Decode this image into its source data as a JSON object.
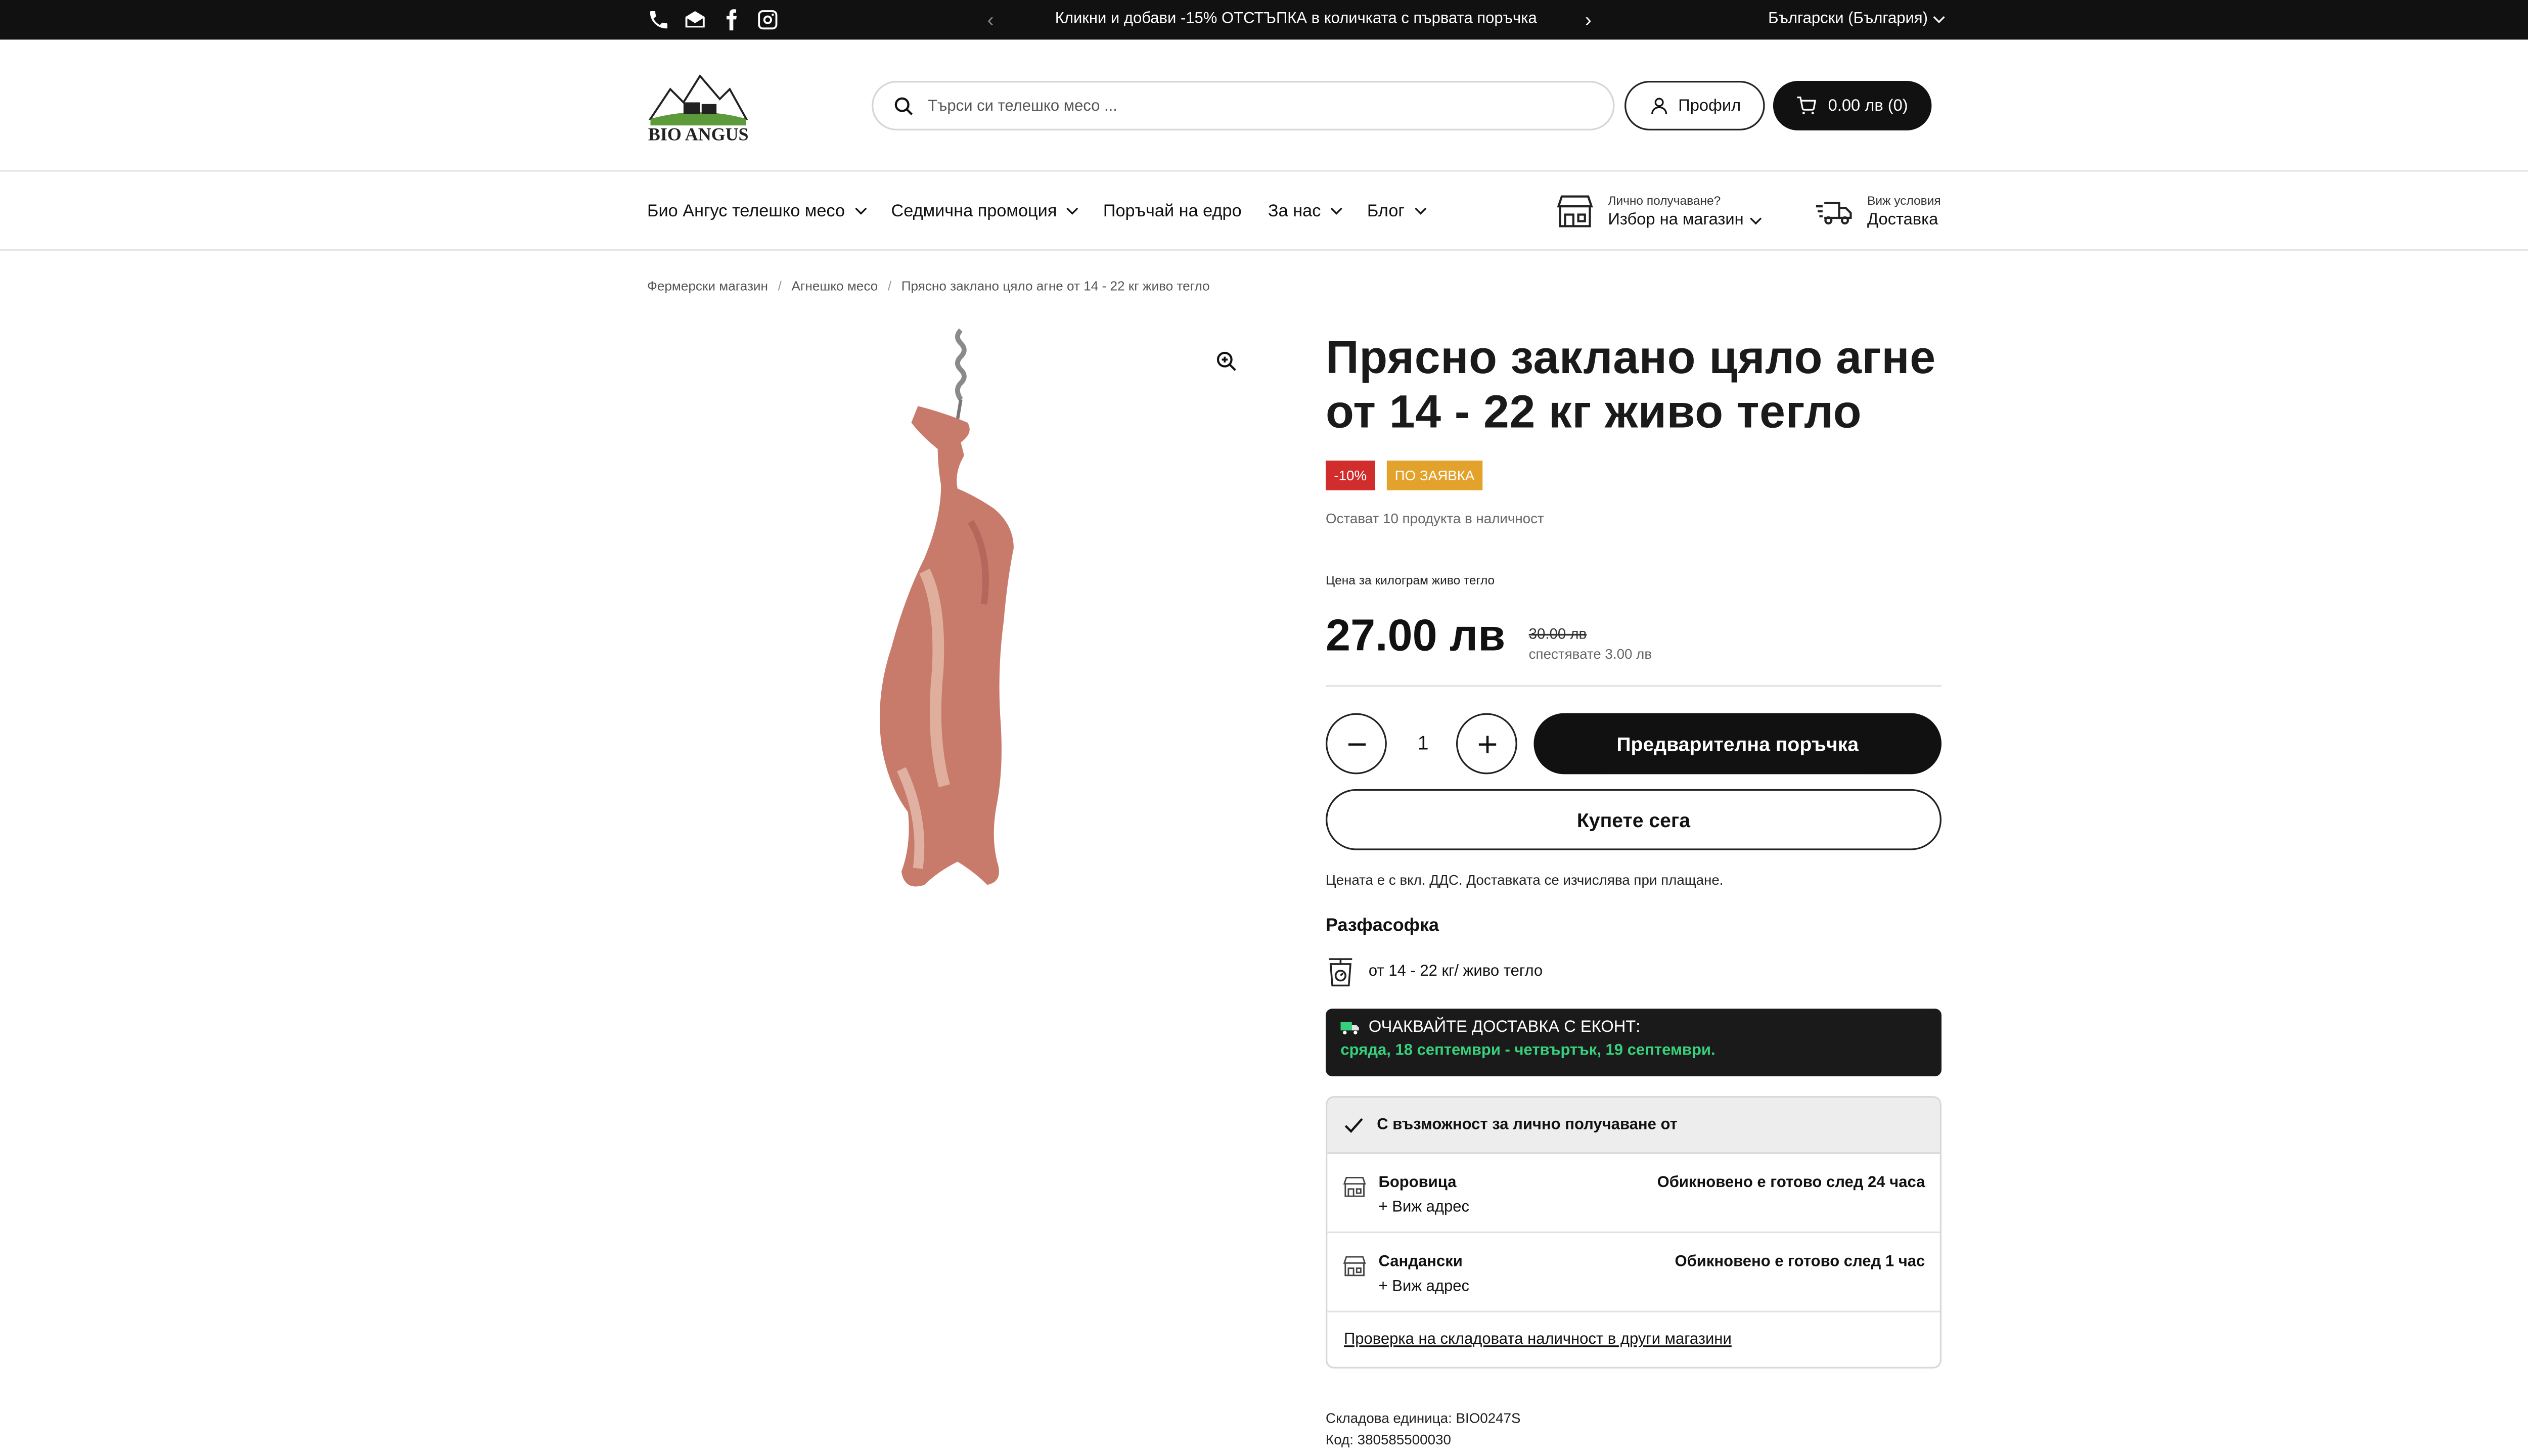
{
  "announcement": {
    "text": "Кликни и добави -15% ОТСТЪПКА в количката с първата поръчка",
    "prev_icon": "chevron-left-icon",
    "next_icon": "chevron-right-icon",
    "language": "Български (България)",
    "socials": [
      "phone-icon",
      "email-icon",
      "facebook-icon",
      "instagram-icon"
    ]
  },
  "header": {
    "logo_text": "BIO ANGUS",
    "search_placeholder": "Търси си телешко месо ...",
    "profile_label": "Профил",
    "cart_label": "0.00 лв (0)"
  },
  "nav": {
    "items": [
      {
        "label": "Био Ангус телешко месо",
        "dropdown": true
      },
      {
        "label": "Седмична промоция",
        "dropdown": true
      },
      {
        "label": "Поръчай на едро",
        "dropdown": false
      },
      {
        "label": "За нас",
        "dropdown": true
      },
      {
        "label": "Блог",
        "dropdown": true
      }
    ],
    "store_small": "Лично получаване?",
    "store_big": "Избор на магазин",
    "delivery_small": "Виж условия",
    "delivery_big": "Доставка"
  },
  "breadcrumb": [
    "Фермерски магазин",
    "Агнешко месо",
    "Прясно заклано цяло агне от 14 - 22 кг живо тегло"
  ],
  "product": {
    "title_line1": "Прясно заклано цяло агне",
    "title_line2": "от 14 - 22 кг живо тегло",
    "badge_discount": "-10%",
    "badge_order": "ПО ЗАЯВКА",
    "stock": "Остават 10 продукта в наличност",
    "unit_note": "Цена за килограм живо тегло",
    "price": "27.00 лв",
    "compare_price": "30.00 лв",
    "savings": "спестявате 3.00 лв",
    "quantity": "1",
    "preorder_label": "Предварителна поръчка",
    "buy_now_label": "Купете сега",
    "vat_note": "Цената е с вкл. ДДС. Доставката се изчислява при плащане.",
    "packaging_heading": "Разфасофка",
    "packaging_value": "от 14 - 22 кг/ живо тегло",
    "delivery_title": "ОЧАКВАЙТЕ ДОСТАВКА С ЕКОНТ:",
    "delivery_dates": "сряда, 18 септември - четвъртък, 19 септември.",
    "pickup_heading": "С възможност за лично получаване от",
    "stores": [
      {
        "name": "Боровица",
        "address_link": "+ Виж адрес",
        "ready": "Обикновено е готово след 24 часа"
      },
      {
        "name": "Сандански",
        "address_link": "+ Виж адрес",
        "ready": "Обикновено е готово след 1 час"
      }
    ],
    "stock_check_link": "Проверка на складовата наличност в други магазини",
    "sku": "Складова единица: BIO0247S",
    "code": "Код: 380585500030"
  },
  "colors": {
    "discount_badge": "#d22d2d",
    "order_badge": "#e3a22b",
    "delivery_dates": "#37d07d",
    "dark": "#111111"
  }
}
